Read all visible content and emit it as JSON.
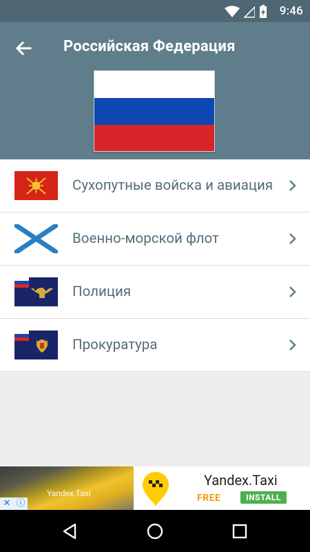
{
  "status_bar": {
    "time": "9:46",
    "icons": [
      "wifi-icon",
      "signal-icon",
      "battery-charging-icon"
    ]
  },
  "app_bar": {
    "title": "Российская Федерация",
    "back_icon": "arrow-back-icon",
    "colors": {
      "appbar": "#607d8b",
      "statusbar": "#4f6772"
    }
  },
  "hero_flag": {
    "name": "flag-russia",
    "stripes": [
      "#ffffff",
      "#0d47b3",
      "#d9252a"
    ]
  },
  "list": {
    "items": [
      {
        "label": "Сухопутные войска и авиация",
        "flag": "ground-forces-flag-icon"
      },
      {
        "label": "Военно-морской флот",
        "flag": "navy-saint-andrew-flag-icon"
      },
      {
        "label": "Полиция",
        "flag": "police-flag-icon"
      },
      {
        "label": "Прокуратура",
        "flag": "prosecutor-flag-icon"
      }
    ],
    "chevron_icon": "chevron-right-icon"
  },
  "ad": {
    "image_caption": "Yandex Taxi",
    "app_name": "Yandex.Taxi",
    "price": "FREE",
    "cta": "INSTALL",
    "badges": [
      "close-icon",
      "info-icon"
    ]
  },
  "nav_bar": {
    "buttons": [
      "back-triangle-icon",
      "home-circle-icon",
      "recents-square-icon"
    ]
  }
}
